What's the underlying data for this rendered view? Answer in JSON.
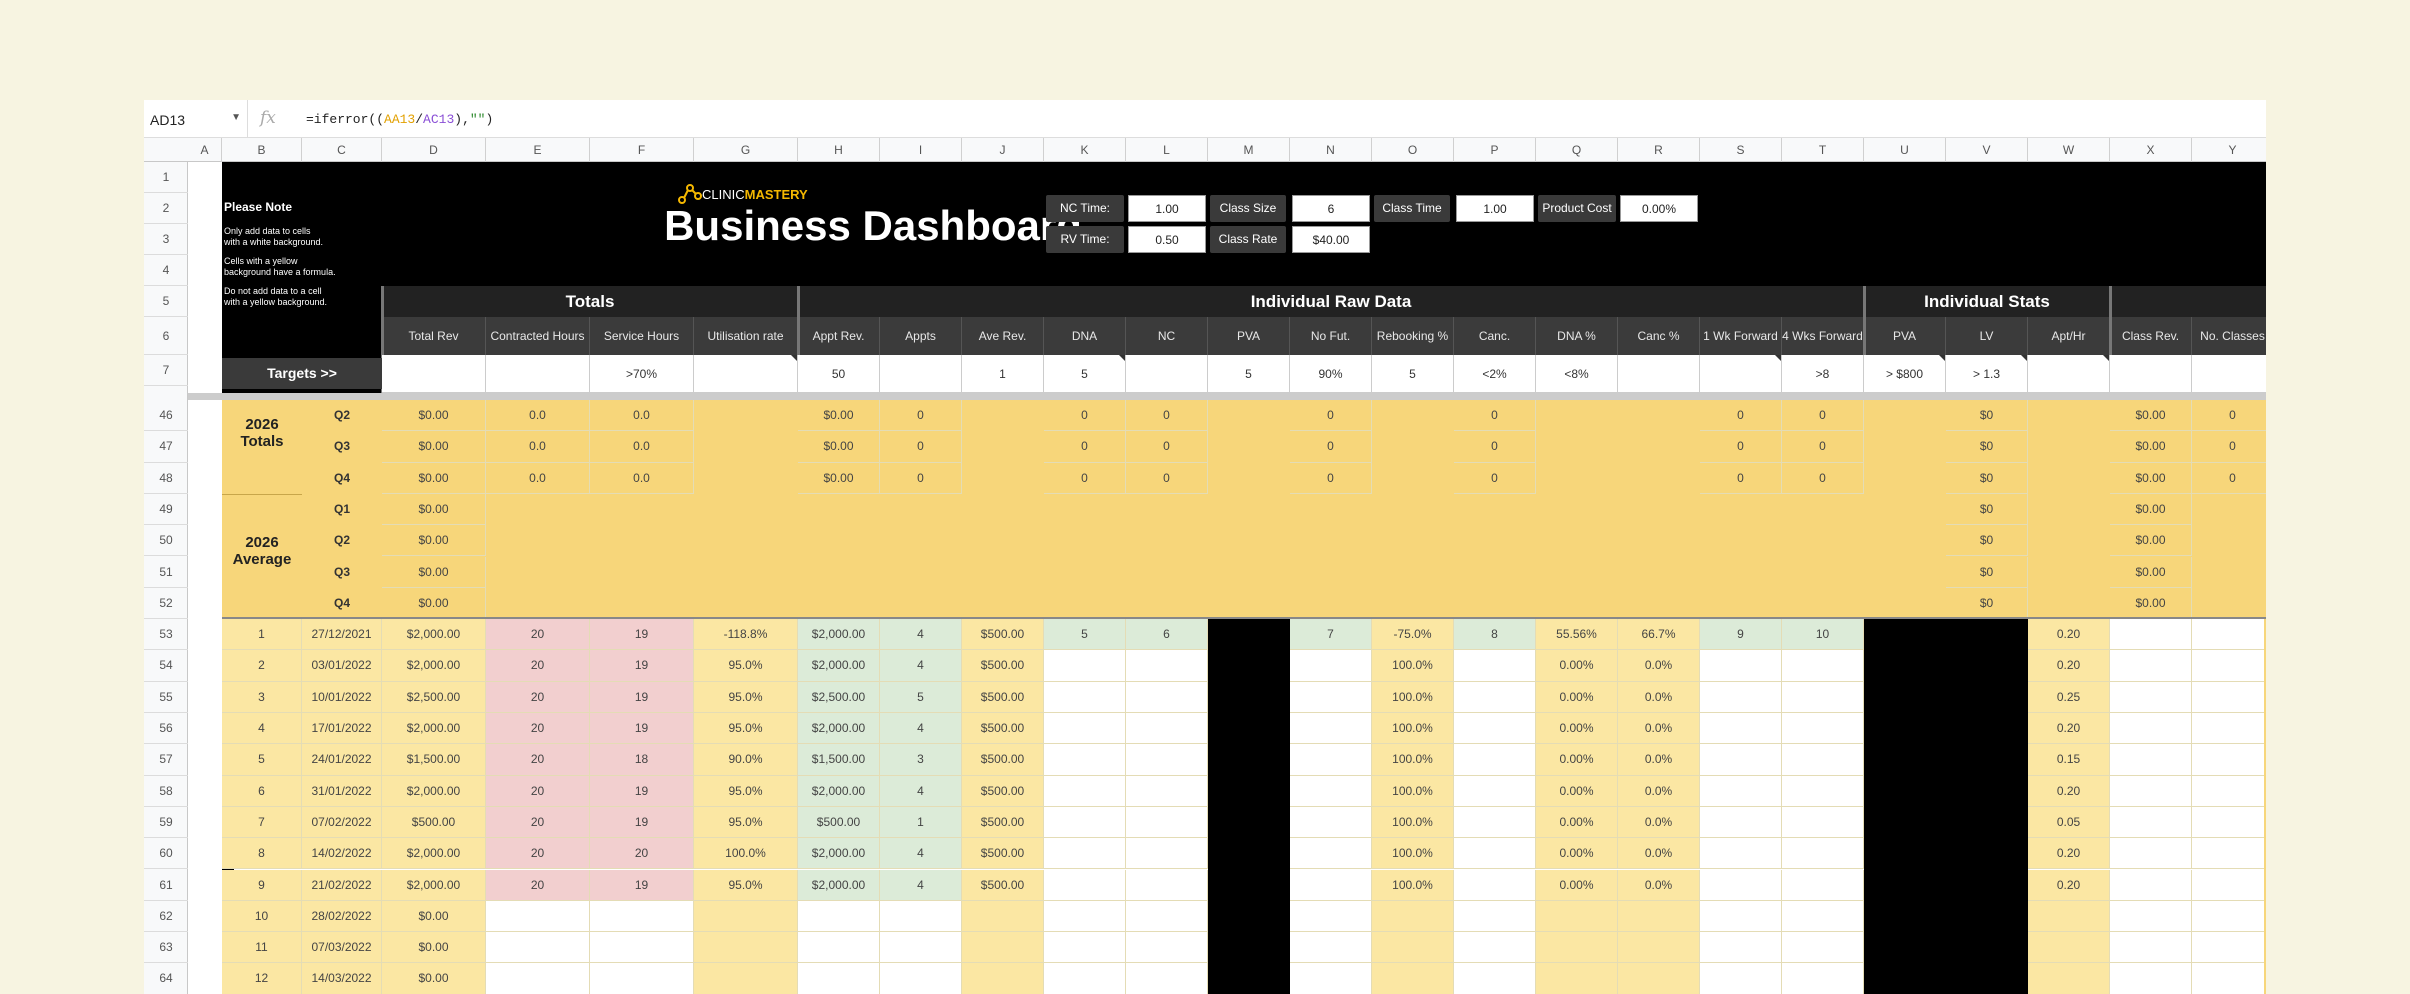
{
  "formula_bar": {
    "cell_ref": "AD13",
    "fx": "fx",
    "formula_parts": [
      "=iferror((",
      "AA13",
      "/",
      "AC13",
      "),",
      "\"\"",
      ")"
    ]
  },
  "columns": [
    "A",
    "B",
    "C",
    "D",
    "E",
    "F",
    "G",
    "H",
    "I",
    "J",
    "K",
    "L",
    "M",
    "N",
    "O",
    "P",
    "Q",
    "R",
    "S",
    "T",
    "U",
    "V",
    "W",
    "X",
    "Y"
  ],
  "row_numbers": [
    "1",
    "2",
    "3",
    "4",
    "5",
    "6",
    "7",
    "46",
    "47",
    "48",
    "49",
    "50",
    "51",
    "52",
    "53",
    "54",
    "55",
    "56",
    "57",
    "58",
    "59",
    "60",
    "61",
    "62",
    "63",
    "64"
  ],
  "note": {
    "title": "Please Note",
    "lines": [
      "Only add data to cells",
      "with a white background.",
      "",
      "Cells with a yellow",
      "background have a formula.",
      "",
      "Do not add data to a cell",
      "with a yellow background."
    ]
  },
  "logo": {
    "clinic": "CLINIC",
    "mastery": "MASTERY"
  },
  "title": "Business Dashboard",
  "params": [
    {
      "label": "NC Time:",
      "value": "1.00"
    },
    {
      "label": "Class Size",
      "value": "6"
    },
    {
      "label": "Class Time",
      "value": "1.00"
    },
    {
      "label": "Product Cost",
      "value": "0.00%"
    },
    {
      "label": "RV Time:",
      "value": "0.50"
    },
    {
      "label": "Class Rate",
      "value": "$40.00"
    }
  ],
  "sections": {
    "totals": "Totals",
    "raw": "Individual Raw Data",
    "stats": "Individual Stats"
  },
  "subheaders": [
    "Total Rev",
    "Contracted Hours",
    "Service Hours",
    "Utilisation rate",
    "Appt Rev.",
    "Appts",
    "Ave Rev.",
    "DNA",
    "NC",
    "PVA",
    "No Fut.",
    "Rebooking %",
    "Canc.",
    "DNA %",
    "Canc %",
    "1 Wk Forward",
    "4 Wks Forward",
    "PVA",
    "LV",
    "Apt/Hr",
    "Class Rev.",
    "No. Classes"
  ],
  "targets_label": "Targets >>",
  "targets": [
    "",
    "",
    "",
    "",
    ">70%",
    "",
    "50",
    "",
    "1",
    "5",
    "",
    "5",
    "90%",
    "5",
    "<2%",
    "<8%",
    "",
    "",
    ">8",
    "> $800",
    "> 1.3",
    "",
    ""
  ],
  "group_2026_totals": {
    "label": "2026 Totals",
    "rows": [
      {
        "q": "Q2",
        "d": "$0.00",
        "e": "0.0",
        "f": "0.0",
        "h": "$0.00",
        "i": "0",
        "k": "0",
        "l": "0",
        "n": "0",
        "p": "0",
        "s": "0",
        "t": "0",
        "v": "$0",
        "x": "$0.00",
        "y": "0"
      },
      {
        "q": "Q3",
        "d": "$0.00",
        "e": "0.0",
        "f": "0.0",
        "h": "$0.00",
        "i": "0",
        "k": "0",
        "l": "0",
        "n": "0",
        "p": "0",
        "s": "0",
        "t": "0",
        "v": "$0",
        "x": "$0.00",
        "y": "0"
      },
      {
        "q": "Q4",
        "d": "$0.00",
        "e": "0.0",
        "f": "0.0",
        "h": "$0.00",
        "i": "0",
        "k": "0",
        "l": "0",
        "n": "0",
        "p": "0",
        "s": "0",
        "t": "0",
        "v": "$0",
        "x": "$0.00",
        "y": "0"
      }
    ]
  },
  "group_2026_average": {
    "label": "2026 Average",
    "rows": [
      {
        "q": "Q1",
        "d": "$0.00",
        "v": "$0",
        "x": "$0.00"
      },
      {
        "q": "Q2",
        "d": "$0.00",
        "v": "$0",
        "x": "$0.00"
      },
      {
        "q": "Q3",
        "d": "$0.00",
        "v": "$0",
        "x": "$0.00"
      },
      {
        "q": "Q4",
        "d": "$0.00",
        "v": "$0",
        "x": "$0.00"
      }
    ]
  },
  "weekly_rows": [
    {
      "b": "1",
      "c": "27/12/2021",
      "d": "$2,000.00",
      "e": "20",
      "f": "19",
      "g": "-118.8%",
      "h": "$2,000.00",
      "i": "4",
      "j": "$500.00",
      "k": "5",
      "l": "6",
      "n": "7",
      "o": "-75.0%",
      "p": "8",
      "q": "55.56%",
      "r": "66.7%",
      "s": "9",
      "t": "10",
      "w": "0.20"
    },
    {
      "b": "2",
      "c": "03/01/2022",
      "d": "$2,000.00",
      "e": "20",
      "f": "19",
      "g": "95.0%",
      "h": "$2,000.00",
      "i": "4",
      "j": "$500.00",
      "o": "100.0%",
      "q": "0.00%",
      "r": "0.0%",
      "w": "0.20"
    },
    {
      "b": "3",
      "c": "10/01/2022",
      "d": "$2,500.00",
      "e": "20",
      "f": "19",
      "g": "95.0%",
      "h": "$2,500.00",
      "i": "5",
      "j": "$500.00",
      "o": "100.0%",
      "q": "0.00%",
      "r": "0.0%",
      "w": "0.25"
    },
    {
      "b": "4",
      "c": "17/01/2022",
      "d": "$2,000.00",
      "e": "20",
      "f": "19",
      "g": "95.0%",
      "h": "$2,000.00",
      "i": "4",
      "j": "$500.00",
      "o": "100.0%",
      "q": "0.00%",
      "r": "0.0%",
      "w": "0.20"
    },
    {
      "b": "5",
      "c": "24/01/2022",
      "d": "$1,500.00",
      "e": "20",
      "f": "18",
      "g": "90.0%",
      "h": "$1,500.00",
      "i": "3",
      "j": "$500.00",
      "o": "100.0%",
      "q": "0.00%",
      "r": "0.0%",
      "w": "0.15"
    },
    {
      "b": "6",
      "c": "31/01/2022",
      "d": "$2,000.00",
      "e": "20",
      "f": "19",
      "g": "95.0%",
      "h": "$2,000.00",
      "i": "4",
      "j": "$500.00",
      "o": "100.0%",
      "q": "0.00%",
      "r": "0.0%",
      "w": "0.20"
    },
    {
      "b": "7",
      "c": "07/02/2022",
      "d": "$500.00",
      "e": "20",
      "f": "19",
      "g": "95.0%",
      "h": "$500.00",
      "i": "1",
      "j": "$500.00",
      "o": "100.0%",
      "q": "0.00%",
      "r": "0.0%",
      "w": "0.05"
    },
    {
      "b": "8",
      "c": "14/02/2022",
      "d": "$2,000.00",
      "e": "20",
      "f": "20",
      "g": "100.0%",
      "h": "$2,000.00",
      "i": "4",
      "j": "$500.00",
      "o": "100.0%",
      "q": "0.00%",
      "r": "0.0%",
      "w": "0.20"
    },
    {
      "b": "9",
      "c": "21/02/2022",
      "d": "$2,000.00",
      "e": "20",
      "f": "19",
      "g": "95.0%",
      "h": "$2,000.00",
      "i": "4",
      "j": "$500.00",
      "o": "100.0%",
      "q": "0.00%",
      "r": "0.0%",
      "w": "0.20"
    },
    {
      "b": "10",
      "c": "28/02/2022",
      "d": "$0.00"
    },
    {
      "b": "11",
      "c": "07/03/2022",
      "d": "$0.00"
    },
    {
      "b": "12",
      "c": "14/03/2022",
      "d": "$0.00"
    }
  ]
}
